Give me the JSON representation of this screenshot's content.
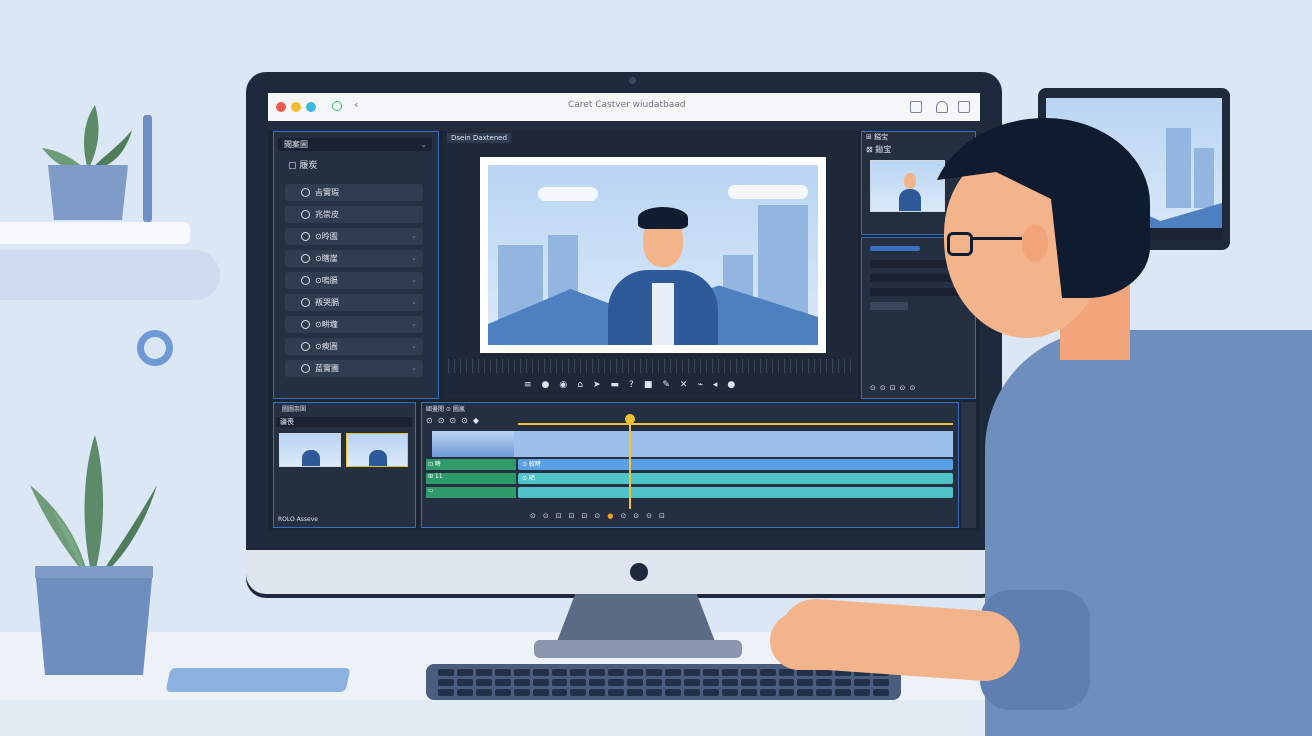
{
  "app": {
    "window_title": "Caret Castver wiudatbaad",
    "menu": [
      "ᅠ",
      "ᅠ",
      "ᅠ",
      "ᅠ",
      "ᅠ",
      "ᅠ"
    ]
  },
  "left_panel": {
    "dropdown": "閲案圌",
    "folder": "履炭",
    "items": [
      {
        "label": "㫖實瑕",
        "chevron": ""
      },
      {
        "label": "兆崇皮",
        "chevron": ""
      },
      {
        "label": "⊙昤圔",
        "chevron": "⌄"
      },
      {
        "label": "⊙瞎崖",
        "chevron": "⌄"
      },
      {
        "label": "⊙嗚膈",
        "chevron": "⌄"
      },
      {
        "label": "叛哭膈",
        "chevron": "⌄"
      },
      {
        "label": "⊙畊壠",
        "chevron": "⌄"
      },
      {
        "label": "⊙瘐圓",
        "chevron": "⌄"
      },
      {
        "label": "蓝實圕",
        "chevron": "⌄"
      }
    ]
  },
  "viewer": {
    "tab": "Dsein Daxtened",
    "controls": [
      "≡",
      "●",
      "◉",
      "⌂",
      "➤",
      "▬",
      "?",
      "■",
      "✎",
      "✕",
      "⌁",
      "◂",
      "●"
    ]
  },
  "right_panel": {
    "header": "⊞ 鎰宝",
    "sub_header": "⊠ 鎰宝"
  },
  "media_bin": {
    "title": "圖圖崇圉",
    "subtitle": "疆喪",
    "footer": "ROLO Asseve"
  },
  "timeline": {
    "title": "國畫閲 ⊙ 圖嵐",
    "tracks": [
      {
        "label": "⊡ 畊",
        "clip": "⊙ 軟畊",
        "color": "#5aa0e6"
      },
      {
        "label": "⊞ 11",
        "clip": "⊙ 晒",
        "color": "#4fc3c8"
      },
      {
        "label": "▭",
        "clip": "",
        "color": "#4fc3c8"
      }
    ],
    "transport": [
      "⊙",
      "⊙",
      "⊡",
      "⊡",
      "⊡",
      "⊙",
      "●",
      "⊙",
      "⊙",
      "⊙",
      "⊡"
    ],
    "playhead_color": "#f2c12e"
  },
  "colors": {
    "accent": "#3a6fc0",
    "panel": "#242f41",
    "timeline_blue": "#5aa0e6",
    "timeline_teal": "#4fc3c8"
  }
}
